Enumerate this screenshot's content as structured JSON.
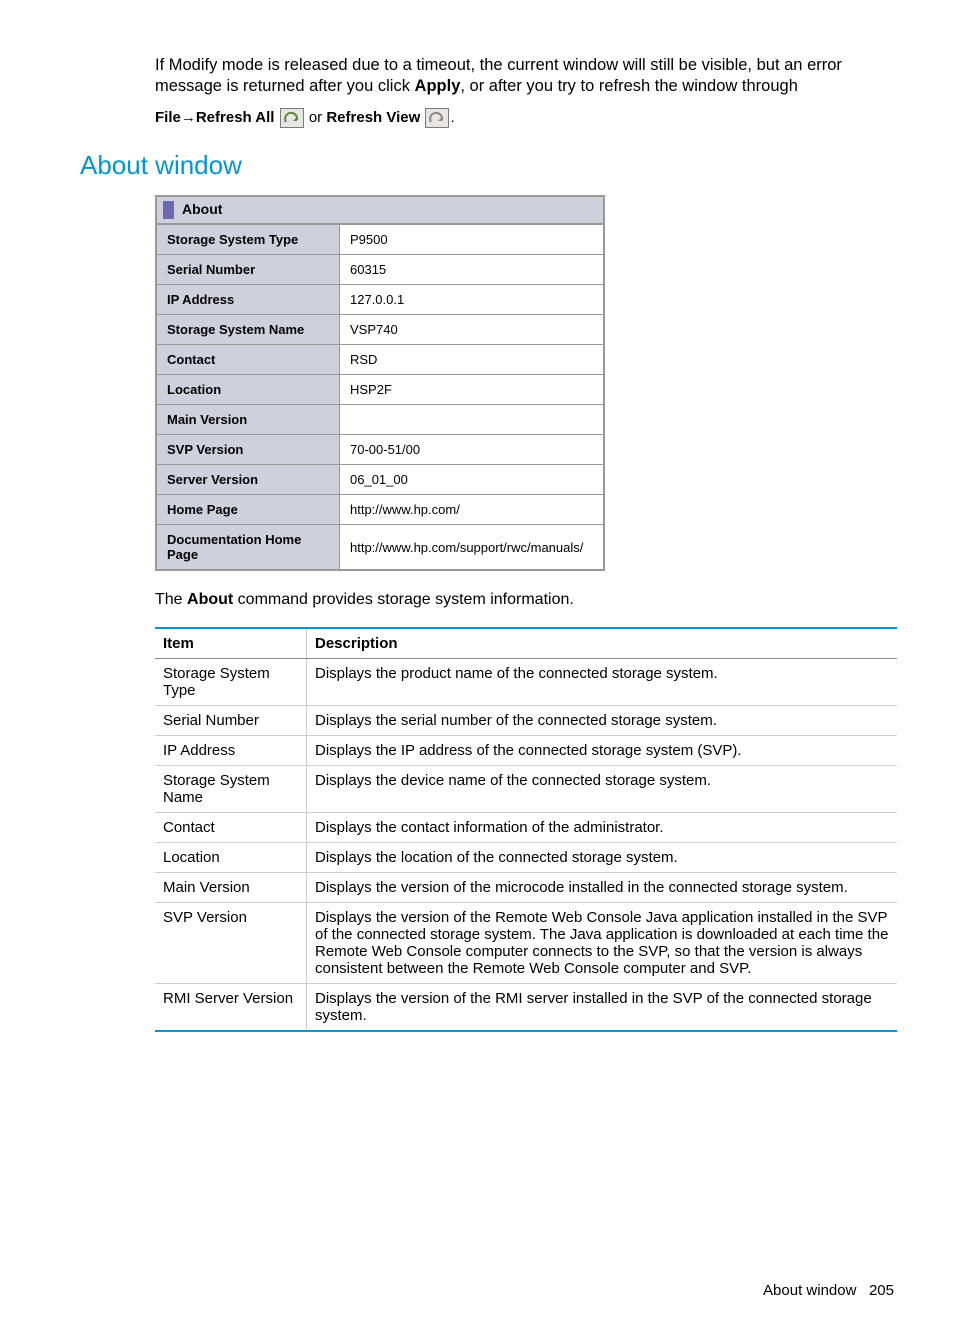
{
  "intro": {
    "line1_a": "If Modify mode is released due to a timeout, the current window will still be visible, but an error message is returned after you click ",
    "line1_bold": "Apply",
    "line1_b": ", or after you try to refresh the window through",
    "refresh_file": "File",
    "refresh_arrow": "→",
    "refresh_all": "Refresh All",
    "refresh_or": " or ",
    "refresh_view": "Refresh View",
    "refresh_end": "."
  },
  "heading": "About window",
  "about": {
    "title": "About",
    "rows": [
      {
        "label": "Storage System Type",
        "value": "P9500"
      },
      {
        "label": "Serial Number",
        "value": "60315"
      },
      {
        "label": "IP Address",
        "value": "127.0.0.1"
      },
      {
        "label": "Storage System Name",
        "value": "VSP740"
      },
      {
        "label": "Contact",
        "value": "RSD"
      },
      {
        "label": "Location",
        "value": "HSP2F"
      },
      {
        "label": "Main Version",
        "value": ""
      },
      {
        "label": "SVP Version",
        "value": "70-00-51/00"
      },
      {
        "label": "Server Version",
        "value": "06_01_00"
      },
      {
        "label": "Home Page",
        "value": "http://www.hp.com/"
      },
      {
        "label": "Documentation Home Page",
        "value": "http://www.hp.com/support/rwc/manuals/"
      }
    ]
  },
  "desc_intro_a": "The ",
  "desc_intro_bold": "About",
  "desc_intro_b": " command provides storage system information.",
  "desc_table": {
    "headers": {
      "item": "Item",
      "description": "Description"
    },
    "rows": [
      {
        "item": "Storage System Type",
        "description": "Displays the product name of the connected storage system."
      },
      {
        "item": "Serial Number",
        "description": "Displays the serial number of the connected storage system."
      },
      {
        "item": "IP Address",
        "description": "Displays the IP address of the connected storage system (SVP)."
      },
      {
        "item": "Storage System Name",
        "description": "Displays the device name of the connected storage system."
      },
      {
        "item": "Contact",
        "description": "Displays the contact information of the administrator."
      },
      {
        "item": "Location",
        "description": "Displays the location of the connected storage system."
      },
      {
        "item": "Main Version",
        "description": "Displays the version of the microcode installed in the connected storage system."
      },
      {
        "item": "SVP Version",
        "description": "Displays the version of the Remote Web Console Java application installed in the SVP of the connected storage system. The Java application is downloaded at each time the Remote Web Console computer connects to the SVP, so that the version is always consistent between the Remote Web Console computer and SVP."
      },
      {
        "item": "RMI Server Version",
        "description": "Displays the version of the RMI server installed in the SVP of the connected storage system."
      }
    ]
  },
  "footer": {
    "label": "About window",
    "page": "205"
  }
}
